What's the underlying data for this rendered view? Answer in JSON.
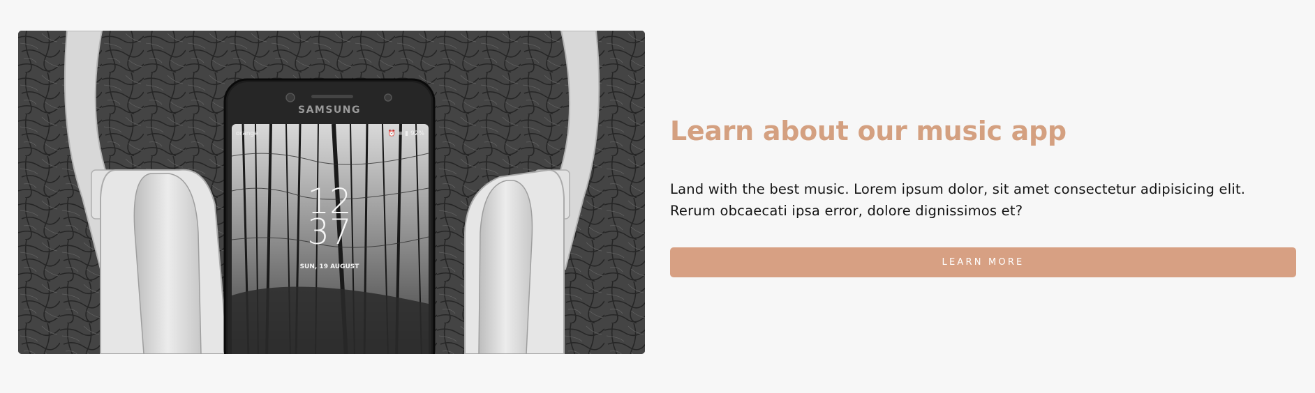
{
  "feature": {
    "image": {
      "alt": "Phone and headphones",
      "phone_brand": "SAMSUNG",
      "carrier": "orange",
      "status": "⏰ ≡ ▮ 92%",
      "clock_hours": "12",
      "clock_minutes": "37",
      "date": "SUN, 19 AUGUST"
    },
    "heading": "Learn about our music app",
    "description": "Land with the best music. Lorem ipsum dolor, sit amet consectetur adipisicing elit. Rerum obcaecati ipsa error, dolore dignissimos et?",
    "button_label": "LEARN MORE"
  },
  "colors": {
    "page_background": "#f7f7f7",
    "heading": "#d4a080",
    "button_background": "#d7a083",
    "button_text": "#ffffff",
    "body_text": "#141414"
  }
}
